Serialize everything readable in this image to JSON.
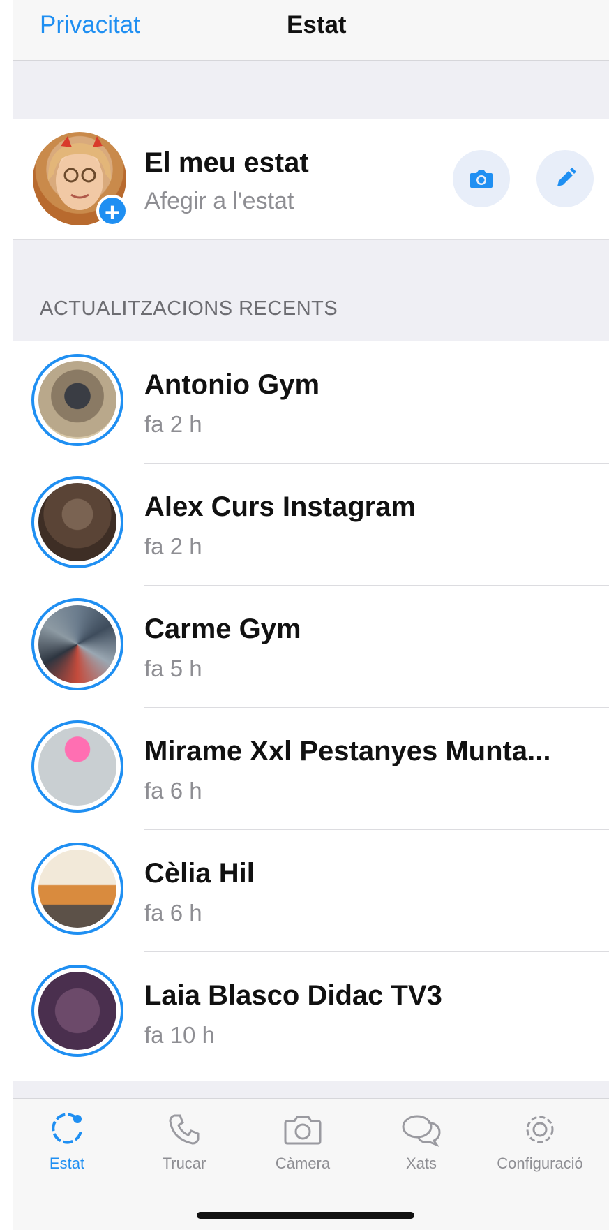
{
  "navbar": {
    "left_label": "Privacitat",
    "title": "Estat"
  },
  "my_status": {
    "name": "El meu estat",
    "subtitle": "Afegir a l'estat",
    "add_badge": "+"
  },
  "section": {
    "header": "ACTUALITZACIONS RECENTS"
  },
  "updates": [
    {
      "name": "Antonio Gym",
      "time": "fa 2 h"
    },
    {
      "name": "Alex Curs Instagram",
      "time": "fa 2 h"
    },
    {
      "name": "Carme Gym",
      "time": "fa 5 h"
    },
    {
      "name": "Mirame Xxl Pestanyes Munta...",
      "time": "fa 6 h"
    },
    {
      "name": "Cèlia Hil",
      "time": "fa 6 h"
    },
    {
      "name": "Laia Blasco Didac TV3",
      "time": "fa 10 h"
    }
  ],
  "tabs": [
    {
      "label": "Estat",
      "icon": "status-icon",
      "active": true
    },
    {
      "label": "Trucar",
      "icon": "phone-icon"
    },
    {
      "label": "Càmera",
      "icon": "camera-icon"
    },
    {
      "label": "Xats",
      "icon": "chats-icon"
    },
    {
      "label": "Configuració",
      "icon": "settings-gear-icon"
    }
  ],
  "colors": {
    "accent": "#1f8ff2",
    "secondary_text": "#8e8e93",
    "background": "#efeff4"
  }
}
